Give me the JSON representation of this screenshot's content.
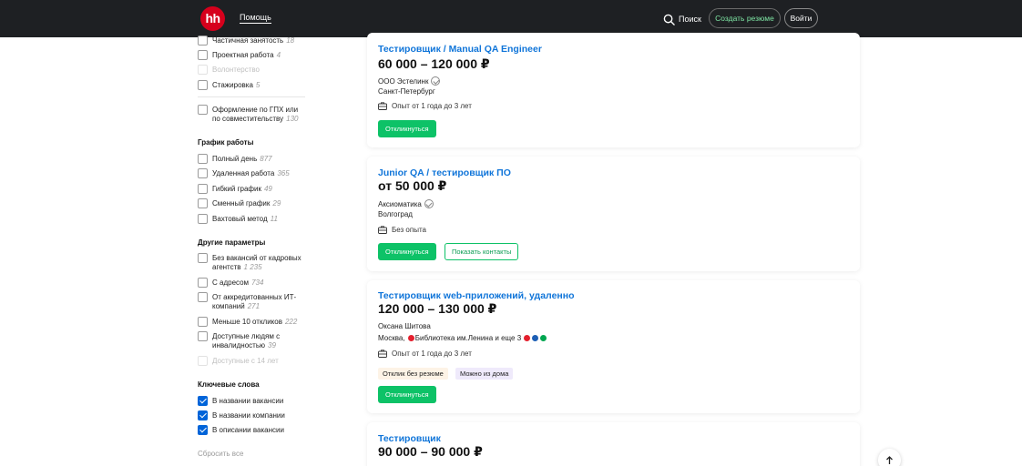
{
  "header": {
    "logo_text": "hh",
    "help_label": "Помощь",
    "search_label": "Поиск",
    "create_resume_label": "Создать резюме",
    "login_label": "Войти",
    "colors": {
      "bg": "#1e2023",
      "logo": "#d6001c",
      "resume_text": "#7fe7a5"
    }
  },
  "sidebar": {
    "employment": [
      {
        "label": "Частичная занятость",
        "count": "18",
        "checked": false,
        "disabled": false
      },
      {
        "label": "Проектная работа",
        "count": "4",
        "checked": false,
        "disabled": false
      },
      {
        "label": "Волонтерство",
        "count": "",
        "checked": false,
        "disabled": true
      },
      {
        "label": "Стажировка",
        "count": "5",
        "checked": false,
        "disabled": false
      },
      {
        "label": "Оформление по ГПХ или по совместительству",
        "count": "130",
        "checked": false,
        "disabled": false
      }
    ],
    "schedule_title": "График работы",
    "schedule": [
      {
        "label": "Полный день",
        "count": "877"
      },
      {
        "label": "Удаленная работа",
        "count": "365"
      },
      {
        "label": "Гибкий график",
        "count": "49"
      },
      {
        "label": "Сменный график",
        "count": "29"
      },
      {
        "label": "Вахтовый метод",
        "count": "11"
      }
    ],
    "other_title": "Другие параметры",
    "other": [
      {
        "label": "Без вакансий от кадровых агентств",
        "count": "1 235",
        "disabled": false
      },
      {
        "label": "С адресом",
        "count": "734",
        "disabled": false
      },
      {
        "label": "От аккредитованных ИТ-компаний",
        "count": "271",
        "disabled": false
      },
      {
        "label": "Меньше 10 откликов",
        "count": "222",
        "disabled": false
      },
      {
        "label": "Доступные людям с инвалидностью",
        "count": "39",
        "disabled": false
      },
      {
        "label": "Доступные с 14 лет",
        "count": "",
        "disabled": true
      }
    ],
    "keywords_title": "Ключевые слова",
    "keywords": [
      {
        "label": "В названии вакансии",
        "checked": true
      },
      {
        "label": "В названии компании",
        "checked": true
      },
      {
        "label": "В описании вакансии",
        "checked": true
      }
    ],
    "reset_label": "Сбросить все"
  },
  "vacancies": [
    {
      "title": "Тестировщик / Manual QA Engineer",
      "salary": "60 000 – 120 000 ₽",
      "company": "ООО Эстелинк",
      "verified": true,
      "city": "Санкт-Петербург",
      "experience": "Опыт от 1 года до 3 лет",
      "apply_label": "Откликнуться"
    },
    {
      "title": "Junior QA / тестировщик ПО",
      "salary": "от 50 000 ₽",
      "company": "Аксиоматика",
      "verified": true,
      "city": "Волгоград",
      "experience": "Без опыта",
      "apply_label": "Откликнуться",
      "contacts_label": "Показать контакты"
    },
    {
      "title": "Тестировщик web-приложений, удаленно",
      "salary": "120 000 – 130 000 ₽",
      "company": "Оксана Шитова",
      "city_prefix": "Москва,",
      "metro": "Библиотека им.Ленина",
      "metro_more": "и еще 3",
      "experience": "Опыт от 1 года до 3 лет",
      "tags": [
        "Отклик без резюме",
        "Можно из дома"
      ],
      "apply_label": "Откликнуться",
      "metro_colors": [
        "#e4202e",
        "#e4202e",
        "#1d5fb5",
        "#00a650"
      ]
    },
    {
      "title": "Тестировщик",
      "salary": "90 000 – 90 000 ₽"
    }
  ]
}
